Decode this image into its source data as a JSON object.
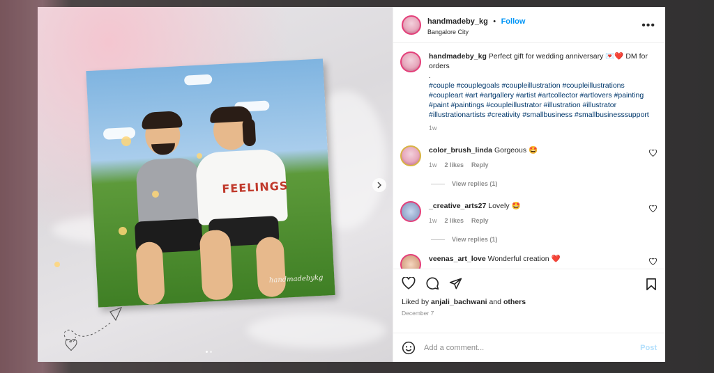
{
  "post": {
    "author": "handmadeby_kg",
    "follow_label": "Follow",
    "location": "Bangalore City",
    "more_label": "•••",
    "artist_signature": "handmadebykg",
    "artwork_text": "FEELINGS"
  },
  "caption": {
    "author": "handmadeby_kg",
    "text": "Perfect gift for wedding anniversary 💌❤️ DM for orders",
    "separator": ".",
    "hashtags": "#couple #couplegoals #coupleillustration #coupleillustrations #coupleart #art #artgallery #artist #artcollector #artlovers #painting #paint #paintings #coupleillustrator #illustration #illustrator #illustrationartists #creativity #smallbusiness #smallbusinesssupport",
    "time": "1w"
  },
  "comments": [
    {
      "user": "color_brush_linda",
      "text": "Gorgeous 🤩",
      "time": "1w",
      "likes": "2 likes",
      "reply": "Reply",
      "view_replies": "View replies (1)"
    },
    {
      "user": "_creative_arts27",
      "text": "Lovely 🤩",
      "time": "1w",
      "likes": "2 likes",
      "reply": "Reply",
      "view_replies": "View replies (1)"
    },
    {
      "user": "veenas_art_love",
      "text": "Wonderful creation ❤️"
    }
  ],
  "engagement": {
    "liked_by_prefix": "Liked by",
    "liked_by_user": "anjali_bachwani",
    "liked_by_and": "and",
    "liked_by_others": "others",
    "date": "December 7"
  },
  "composer": {
    "placeholder": "Add a comment...",
    "post_label": "Post"
  },
  "icons": {
    "like": "heart-icon",
    "comment": "comment-icon",
    "share": "share-icon",
    "save": "bookmark-icon",
    "emoji": "emoji-icon",
    "next": "chevron-right-icon"
  },
  "colors": {
    "link_blue": "#0095f6",
    "hashtag": "#00376b",
    "muted": "#8e8e8e"
  }
}
